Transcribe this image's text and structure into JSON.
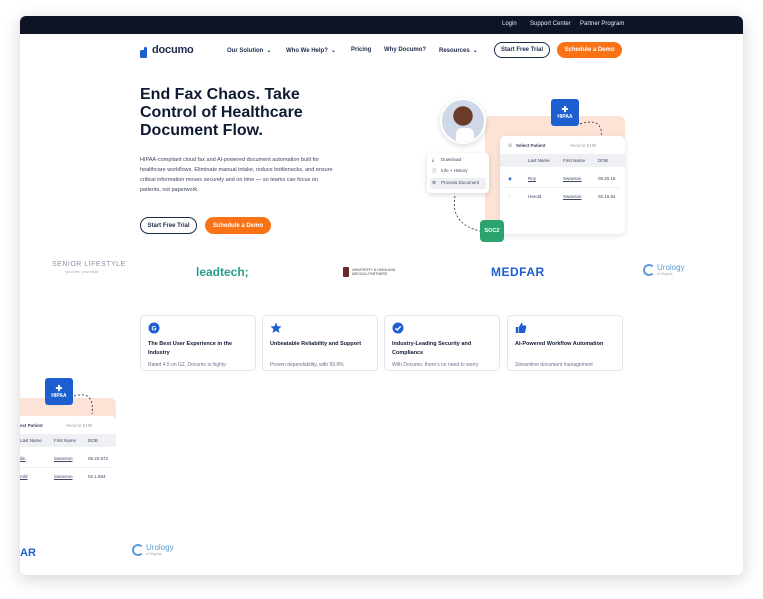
{
  "topbar": {
    "login": "Login",
    "support": "Support Center",
    "partner": "Partner Program"
  },
  "brand": {
    "name": "documo",
    "color": "#1d5fd1"
  },
  "nav": {
    "items": [
      {
        "label": "Our Solution",
        "has_dropdown": true
      },
      {
        "label": "Who We Help?",
        "has_dropdown": true
      },
      {
        "label": "Pricing",
        "has_dropdown": false
      },
      {
        "label": "Why Documo?",
        "has_dropdown": false
      },
      {
        "label": "Resources",
        "has_dropdown": true
      }
    ],
    "cta_trial": "Start Free Trial",
    "cta_demo": "Schedule a Demo"
  },
  "hero": {
    "title": "End Fax Chaos. Take Control of Healthcare Document Flow.",
    "body": "HIPAA-compliant cloud fax and AI-powered document automation built for healthcare workflows. Eliminate manual intake, reduce bottlenecks, and ensure critical information moves securely and on time — so teams can focus on patients, not paperwork.",
    "cta_trial": "Start Free Trial",
    "cta_demo": "Schedule a Demo"
  },
  "illustration": {
    "hipaa_badge": "HIPAA",
    "soc_badge": "SOC2",
    "table_title": "Select Patient",
    "table_step": "Send to EHR",
    "columns": [
      "Last Name",
      "First Name",
      "DOB"
    ],
    "rows": [
      [
        "Roy",
        "Swanson",
        "09.20.16"
      ],
      [
        "Harold",
        "Swanson",
        "02.16.84"
      ]
    ],
    "menu": [
      "Download",
      "Info + History",
      "Process Document"
    ]
  },
  "logos": {
    "senior": "SENIOR LIFESTYLE",
    "senior_tag": "your life, your style",
    "leadtech": "leadtech;",
    "university": "UNIVERSITY & HIGHLAND MEDICAL PARTNERS",
    "medfar": "MEDFAR",
    "urology": "Urology",
    "urology_tag": "of Virginia"
  },
  "features": [
    {
      "icon": "g2-icon",
      "title": "The Best User Experience in the Industry",
      "body": "Rated 4.5 on G2, Documo is highly-"
    },
    {
      "icon": "star-icon",
      "title": "Unbeatable Reliability and Support",
      "body": "Proven dependability, with 99.9%"
    },
    {
      "icon": "shield-check-icon",
      "title": "Industry-Leading Security and Compliance",
      "body": "With Documo, there's no need to worry"
    },
    {
      "icon": "thumbs-up-icon",
      "title": "AI-Powered Workflow Automation",
      "body": "Streamline document management"
    }
  ],
  "repeat_illustration": {
    "hipaa_badge": "HIPAA",
    "table_title": "ect Patient",
    "table_step": "Send to EHR",
    "columns": [
      "Last Name",
      "First Name",
      "DOB"
    ],
    "rows": [
      [
        "ilin",
        "Swanson",
        "05.20.872"
      ],
      [
        "rold",
        "Swanson",
        "02.1.884"
      ]
    ]
  },
  "repeat_logos": {
    "medfar_partial": "AR",
    "urology": "Urology",
    "urology_tag": "of Virginia"
  },
  "colors": {
    "accent": "#f97316",
    "navy": "#0f1a33",
    "blue": "#1d5fd1",
    "green": "#2aa36e",
    "peach": "#fde3d6"
  }
}
